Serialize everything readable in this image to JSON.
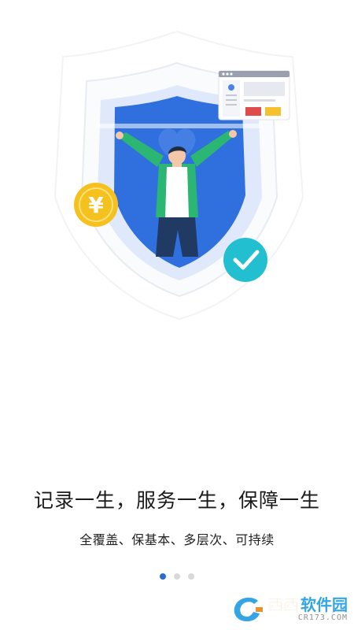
{
  "onboarding": {
    "headline": "记录一生，服务一生，保障一生",
    "subline": "全覆盖、保基本、多层次、可持续",
    "page_indicator": {
      "total": 3,
      "active_index": 0
    }
  },
  "illustration": {
    "coin_symbol": "¥",
    "colors": {
      "shield_blue": "#2f6fde",
      "shield_light": "#e3ecfb",
      "coin_yellow": "#f5c11f",
      "check_teal": "#21bfd0",
      "jacket_green": "#2bb673",
      "red_block": "#e04b4b",
      "yellow_block": "#f5c12e"
    }
  },
  "watermark": {
    "brand_xixi": "西西",
    "brand_name": "软件园",
    "url": "CR173.COM"
  }
}
